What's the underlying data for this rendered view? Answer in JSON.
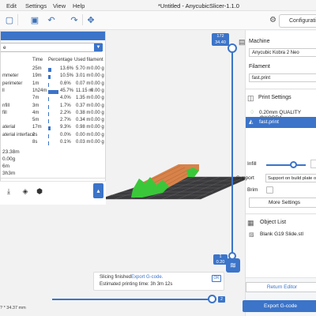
{
  "menu": {
    "edit": "Edit",
    "settings": "Settings",
    "view": "View",
    "help": "Help"
  },
  "app_title": "*Untitled - AnycubicSlicer-1.1.0",
  "toolbar": {
    "configuration_label": "Configurati"
  },
  "stats": {
    "view_value": "e",
    "columns": {
      "time": "Time",
      "percentage": "Percentage",
      "used_filament": "Used filament"
    },
    "rows": [
      {
        "feature": "",
        "time": "25m",
        "percent": "13.6%",
        "pct_value": 13.6,
        "length": "5.70 m",
        "weight": "0.00 g"
      },
      {
        "feature": "mmeter",
        "time": "19m",
        "percent": "10.5%",
        "pct_value": 10.5,
        "length": "3.01 m",
        "weight": "0.00 g"
      },
      {
        "feature": "perimeter",
        "time": "1m",
        "percent": "0.6%",
        "pct_value": 0.6,
        "length": "0.07 m",
        "weight": "0.00 g"
      },
      {
        "feature": "ll",
        "time": "1h24m",
        "percent": "45.7%",
        "pct_value": 45.7,
        "length": "11.15 m",
        "weight": "0.00 g"
      },
      {
        "feature": "",
        "time": "7m",
        "percent": "4.0%",
        "pct_value": 4.0,
        "length": "1.35 m",
        "weight": "0.00 g"
      },
      {
        "feature": "nfill",
        "time": "3m",
        "percent": "1.7%",
        "pct_value": 1.7,
        "length": "0.37 m",
        "weight": "0.00 g"
      },
      {
        "feature": "fill",
        "time": "4m",
        "percent": "2.2%",
        "pct_value": 2.2,
        "length": "0.38 m",
        "weight": "0.00 g"
      },
      {
        "feature": "",
        "time": "5m",
        "percent": "2.7%",
        "pct_value": 2.7,
        "length": "0.34 m",
        "weight": "0.00 g"
      },
      {
        "feature": "aterial",
        "time": "17m",
        "percent": "9.3%",
        "pct_value": 9.3,
        "length": "0.98 m",
        "weight": "0.00 g"
      },
      {
        "feature": "aterial interface",
        "time": "2s",
        "percent": "0.0%",
        "pct_value": 0.0,
        "length": "0.00 m",
        "weight": "0.00 g"
      },
      {
        "feature": "",
        "time": "8s",
        "percent": "0.1%",
        "pct_value": 0.1,
        "length": "0.03 m",
        "weight": "0.00 g"
      }
    ],
    "summary": [
      "23.38m",
      "0.00g",
      "6m",
      "3h3m"
    ]
  },
  "layer_slider": {
    "top_value": "172",
    "top_height": "34.40",
    "bottom_value": "1",
    "bottom_height": "0.20"
  },
  "move_slider": {
    "label": "2"
  },
  "coords": "? * 34.37 mm",
  "notification": {
    "line1": "Slicing finished.",
    "link": "Export G-code.",
    "line2": "Estimated printing time: 3h 3m 12s",
    "ok": "OK"
  },
  "right_panel": {
    "machine_label": "Machine",
    "machine_value": "Anycubic Kobra 2 Neo",
    "filament_label": "Filament",
    "filament_value": "fast.print",
    "print_settings_label": "Print Settings",
    "quality_value": "0.20mm QUALITY @KOBRA",
    "fast_value": "fast.print",
    "infill_label": "Infill",
    "infill_level": 0.7,
    "support_label": "Support",
    "support_value": "Support on build plate o",
    "brim_label": "Brim",
    "more_settings_label": "More Settings",
    "object_list_label": "Object List",
    "object_name": "Blank G19 Slide.stl",
    "return_editor_label": "Return Editor",
    "export_gcode_label": "Export G-code"
  },
  "colors": {
    "accent": "#3b74c9",
    "model_orange": "#d8824a",
    "support_green": "#3ac83a"
  }
}
